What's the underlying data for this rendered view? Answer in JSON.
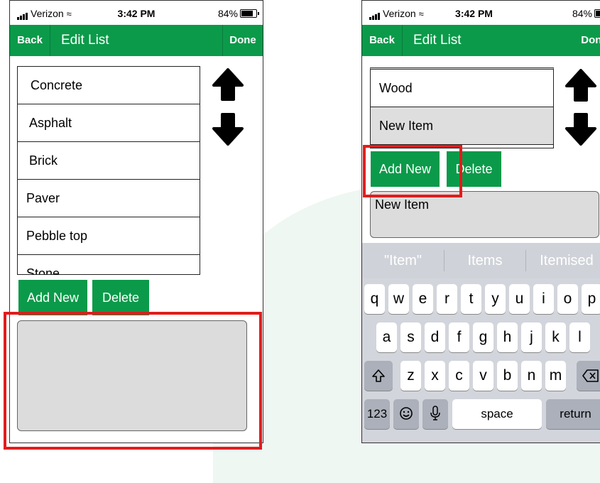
{
  "status_bar": {
    "carrier": "Verizon",
    "time": "3:42 PM",
    "battery": "84%"
  },
  "nav": {
    "back_label": "Back",
    "title": "Edit List",
    "done_label": "Done"
  },
  "left": {
    "list_items": [
      "Concrete",
      "Asphalt",
      "Brick",
      "Paver",
      "Pebble top",
      "Stone"
    ],
    "add_label": "Add New",
    "delete_label": "Delete",
    "text_value": ""
  },
  "right": {
    "list_items": [
      "Wood",
      "New Item"
    ],
    "selected_index": 1,
    "add_label": "Add New",
    "delete_label": "Delete",
    "text_value": "New Item"
  },
  "keyboard": {
    "suggestions": [
      "\"Item\"",
      "Items",
      "Itemised"
    ],
    "row1": [
      "q",
      "w",
      "e",
      "r",
      "t",
      "y",
      "u",
      "i",
      "o",
      "p"
    ],
    "row2": [
      "a",
      "s",
      "d",
      "f",
      "g",
      "h",
      "j",
      "k",
      "l"
    ],
    "row3": [
      "z",
      "x",
      "c",
      "v",
      "b",
      "n",
      "m"
    ],
    "numbers_label": "123",
    "space_label": "space",
    "return_label": "return"
  },
  "colors": {
    "nav_green": "#0b9a4a",
    "highlight_red": "#e31b1b",
    "keyboard_bg": "#d2d5db"
  }
}
